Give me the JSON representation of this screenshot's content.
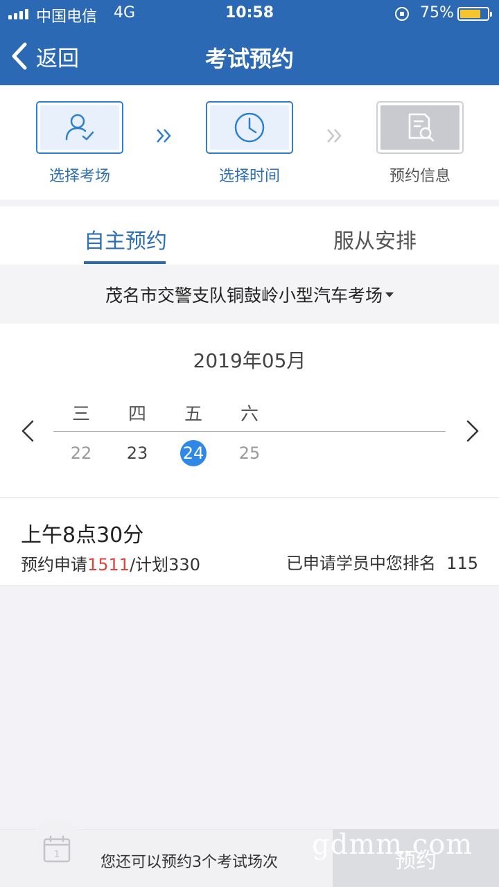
{
  "status_bar": {
    "carrier": "中国电信",
    "network": "4G",
    "time": "10:58",
    "battery_percent": "75%",
    "battery_level": 0.75
  },
  "nav": {
    "back_label": "返回",
    "title": "考试预约"
  },
  "steps": [
    {
      "label": "选择考场",
      "icon": "user-check-icon",
      "state": "active"
    },
    {
      "label": "选择时间",
      "icon": "clock-icon",
      "state": "active"
    },
    {
      "label": "预约信息",
      "icon": "document-search-icon",
      "state": "disabled"
    }
  ],
  "tabs": [
    {
      "label": "自主预约",
      "active": true
    },
    {
      "label": "服从安排",
      "active": false
    }
  ],
  "venue": {
    "name": "茂名市交警支队铜鼓岭小型汽车考场"
  },
  "calendar": {
    "month": "2019年05月",
    "weekdays": [
      "三",
      "四",
      "五",
      "六"
    ],
    "days": [
      "22",
      "23",
      "24",
      "25"
    ],
    "selected_day": "24"
  },
  "session": {
    "time": "上午8点30分",
    "apply_prefix": "预约申请",
    "apply_count": "1511",
    "plan_text": "/计划330",
    "rank_text": "已申请学员中您排名  115"
  },
  "bottom": {
    "remaining_text": "您还可以预约3个考试场次",
    "book_label": "预约",
    "calendar_icon_number": "1"
  },
  "watermark": "gdmm.com",
  "colors": {
    "brand": "#2c69b4",
    "selected_day": "#2f87e6",
    "apply_highlight": "#e0413a",
    "disabled_button": "#dcdde1"
  }
}
